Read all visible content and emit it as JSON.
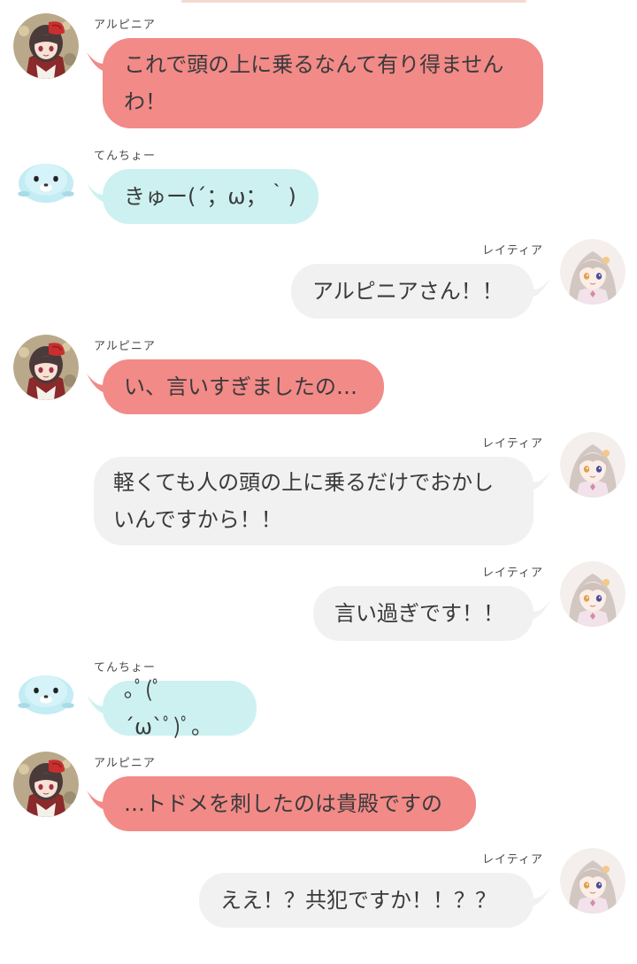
{
  "colors": {
    "albiniar_bubble": "#f28a88",
    "tencho_bubble": "#cdf1f1",
    "leitia_bubble": "#f1f1f1",
    "text": "#3a3a3a"
  },
  "messages": [
    {
      "speaker": "アルピニア",
      "side": "left",
      "avatar": "albiniar-avatar",
      "text": "これで頭の上に乗るなんて有り得ませんわ！"
    },
    {
      "speaker": "てんちょー",
      "side": "left",
      "avatar": "tencho-avatar",
      "text": "きゅー(´；ω；｀)"
    },
    {
      "speaker": "レイティア",
      "side": "right",
      "avatar": "leitia-avatar",
      "text": "アルピニアさん！！"
    },
    {
      "speaker": "アルピニア",
      "side": "left",
      "avatar": "albiniar-avatar",
      "text": "い、言いすぎましたの…"
    },
    {
      "speaker": "レイティア",
      "side": "right",
      "avatar": "leitia-avatar",
      "text": "軽くても人の頭の上に乗るだけでおかしいんですから！！"
    },
    {
      "speaker": "レイティア",
      "side": "right",
      "avatar": "leitia-avatar",
      "text": "言い過ぎです！！"
    },
    {
      "speaker": "てんちょー",
      "side": "left",
      "avatar": "tencho-avatar",
      "text": "｡ﾟ(ﾟ´ω`ﾟ)ﾟ｡"
    },
    {
      "speaker": "アルピニア",
      "side": "left",
      "avatar": "albiniar-avatar",
      "text": "…トドメを刺したのは貴殿ですの"
    },
    {
      "speaker": "レイティア",
      "side": "right",
      "avatar": "leitia-avatar",
      "text": "ええ！？共犯ですか！！？？"
    }
  ]
}
